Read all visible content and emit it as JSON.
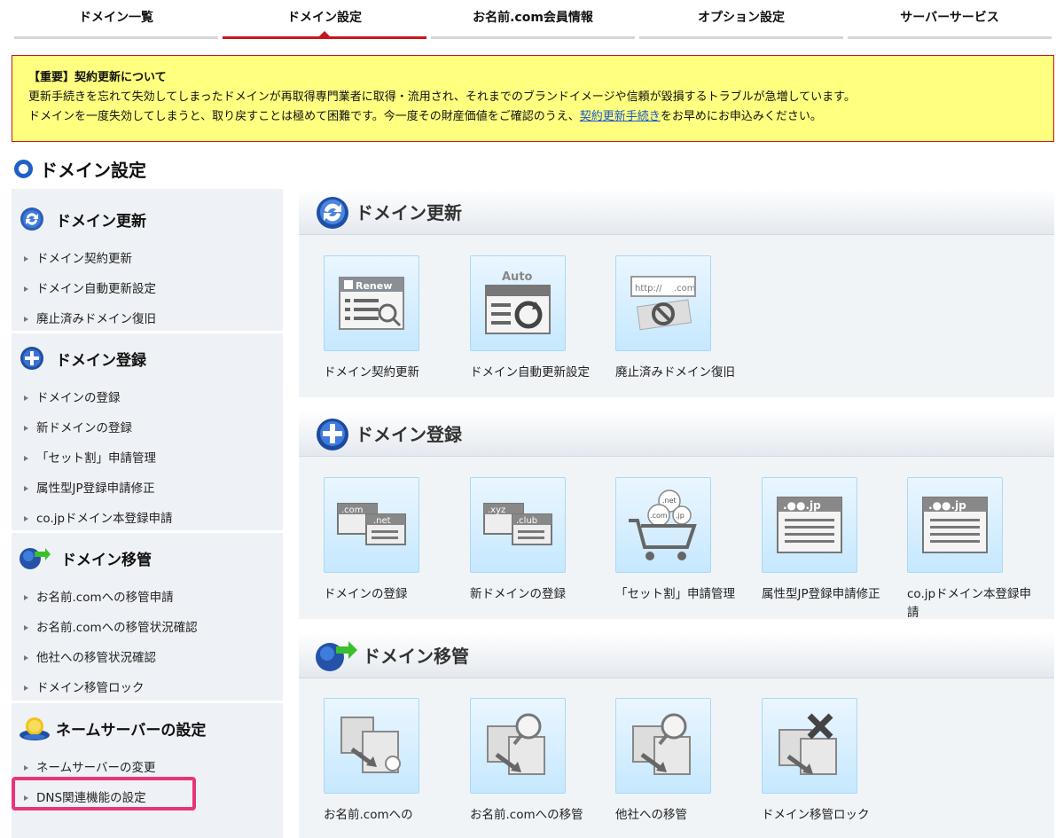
{
  "topnav": {
    "tabs": [
      "ドメイン一覧",
      "ドメイン設定",
      "お名前.com会員情報",
      "オプション設定",
      "サーバーサービス"
    ]
  },
  "notice": {
    "title": "【重要】契約更新について",
    "line1": "更新手続きを忘れて失効してしまったドメインが再取得専門業者に取得・流用され、それまでのブランドイメージや信頼が毀損するトラブルが急増しています。",
    "line2_a": "ドメインを一度失効してしまうと、取り戻すことは極めて困難です。今一度その財産価値をご確認のうえ、",
    "line2_link": "契約更新手続き",
    "line2_b": "をお早めにお申込みください。"
  },
  "page": {
    "title": "ドメイン設定"
  },
  "sidebar": {
    "renew": {
      "title": "ドメイン更新",
      "items": [
        "ドメイン契約更新",
        "ドメイン自動更新設定",
        "廃止済みドメイン復旧"
      ]
    },
    "register": {
      "title": "ドメイン登録",
      "items": [
        "ドメインの登録",
        "新ドメインの登録",
        "「セット割」申請管理",
        "属性型JP登録申請修正",
        "co.jpドメイン本登録申請"
      ]
    },
    "transfer": {
      "title": "ドメイン移管",
      "items": [
        "お名前.comへの移管申請",
        "お名前.comへの移管状況確認",
        "他社への移管状況確認",
        "ドメイン移管ロック"
      ]
    },
    "nameserver": {
      "title": "ネームサーバーの設定",
      "items": [
        "ネームサーバーの変更",
        "DNS関連機能の設定"
      ]
    }
  },
  "panels": {
    "renew": {
      "title": "ドメイン更新",
      "tiles": [
        {
          "label": "ドメイン契約更新",
          "img_text": "Renew"
        },
        {
          "label": "ドメイン自動更新設定",
          "img_text": "Auto"
        },
        {
          "label": "廃止済みドメイン復旧",
          "img_text": "http://",
          "img_text2": ".com"
        }
      ]
    },
    "register": {
      "title": "ドメイン登録",
      "tiles": [
        {
          "label": "ドメインの登録",
          "img_text": ".com",
          "img_text2": ".net"
        },
        {
          "label": "新ドメインの登録",
          "img_text": ".xyz",
          "img_text2": ".club"
        },
        {
          "label": "「セット割」申請管理",
          "img_text": ".com",
          "img_text2": ".jp",
          "img_text3": ".net"
        },
        {
          "label": "属性型JP登録申請修正",
          "img_text": ".●●.jp"
        },
        {
          "label": "co.jpドメイン本登録申請",
          "img_text": ".●●.jp"
        }
      ]
    },
    "transfer": {
      "title": "ドメイン移管",
      "tiles": [
        {
          "label": "お名前.comへの"
        },
        {
          "label": "お名前.comへの移管"
        },
        {
          "label": "他社への移管"
        },
        {
          "label": "ドメイン移管ロック"
        }
      ]
    }
  },
  "colors": {
    "accent": "#c8161d",
    "link": "#1a55c8",
    "notice_bg": "#ffff80",
    "highlight": "#e8357a"
  }
}
